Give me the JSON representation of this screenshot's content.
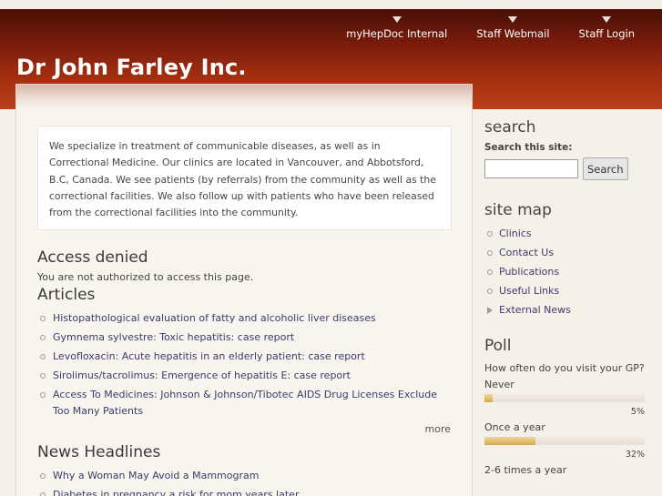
{
  "topnav": [
    {
      "label": "myHepDoc Internal"
    },
    {
      "label": "Staff Webmail"
    },
    {
      "label": "Staff Login"
    }
  ],
  "site_title": "Dr John Farley Inc.",
  "intro_text": "We specialize in treatment of communicable diseases, as well as in Correctional Medicine. Our clinics are located in Vancouver, and Abbotsford, B.C, Canada. We see patients (by referrals) from the community as well as the correctional facilities. We also follow up with patients who have been released from the correctional facilities into the community.",
  "access": {
    "title": "Access denied",
    "message": "You are not authorized to access this page."
  },
  "articles": {
    "title": "Articles",
    "items": [
      "Histopathological evaluation of fatty and alcoholic liver diseases",
      "Gymnema sylvestre: Toxic hepatitis: case report",
      "Levofloxacin: Acute hepatitis in an elderly patient: case report",
      "Sirolimus/tacrolimus: Emergence of hepatitis E: case report",
      "Access To Medicines: Johnson & Johnson/Tibotec AIDS Drug Licenses Exclude Too Many Patients"
    ],
    "more": "more"
  },
  "news": {
    "title": "News Headlines",
    "items": [
      "Why a Woman May Avoid a Mammogram",
      "Diabetes in pregnancy a risk for mom years later"
    ]
  },
  "search": {
    "title": "search",
    "label": "Search this site:",
    "value": "",
    "button": "Search"
  },
  "sitemap": {
    "title": "site map",
    "items": [
      "Clinics",
      "Contact Us",
      "Publications",
      "Useful Links",
      "External News"
    ]
  },
  "poll": {
    "title": "Poll",
    "question": "How often do you visit your GP?",
    "options": [
      {
        "label": "Never",
        "percent_text": "5%",
        "percent": 5
      },
      {
        "label": "Once a year",
        "percent_text": "32%",
        "percent": 32
      },
      {
        "label": "2-6 times a year"
      }
    ]
  }
}
